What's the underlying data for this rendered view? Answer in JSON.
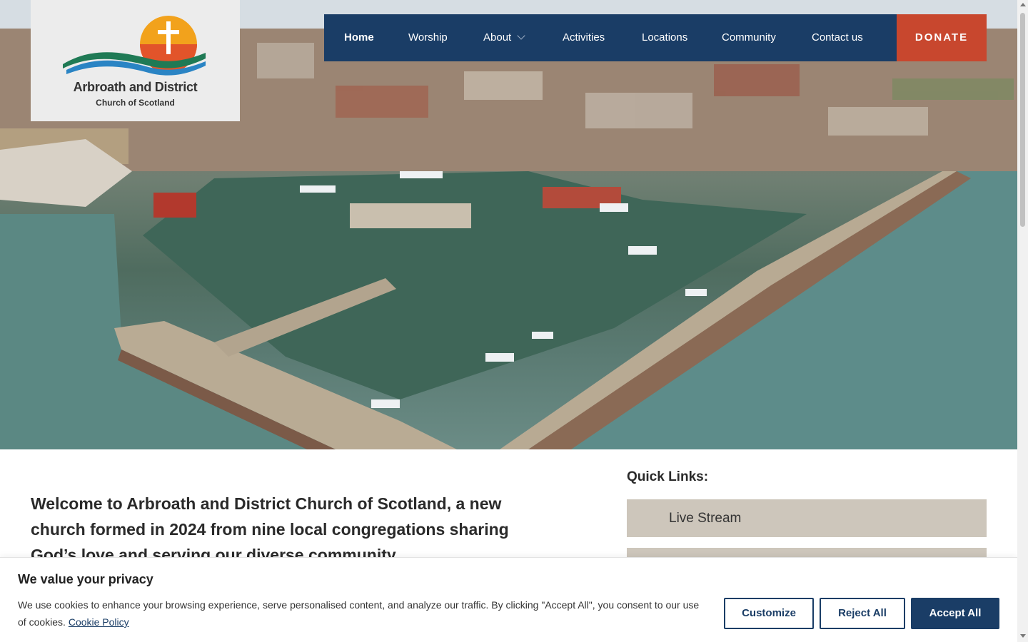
{
  "logo": {
    "title": "Arbroath and District",
    "subtitle": "Church of Scotland"
  },
  "nav": {
    "items": [
      {
        "label": "Home",
        "active": true
      },
      {
        "label": "Worship"
      },
      {
        "label": "About",
        "has_dropdown": true
      },
      {
        "label": "Activities"
      },
      {
        "label": "Locations"
      },
      {
        "label": "Community"
      },
      {
        "label": "Contact us"
      }
    ],
    "donate_label": "DONATE"
  },
  "hero": {
    "alt": "Aerial view of Arbroath harbour"
  },
  "main": {
    "welcome": "Welcome to Arbroath and District Church of Scotland, a new church formed in 2024 from nine local congregations sharing God’s love and serving our diverse community."
  },
  "quick_links": {
    "title": "Quick Links:",
    "items": [
      "Live Stream",
      ""
    ]
  },
  "cookie": {
    "title": "We value your privacy",
    "text": "We use cookies to enhance your browsing experience, serve personalised content, and analyze our traffic. By clicking \"Accept All\", you consent to our use of cookies.",
    "link": "Cookie Policy",
    "customize": "Customize",
    "reject": "Reject All",
    "accept": "Accept All"
  },
  "colors": {
    "nav_bg": "#1a3d66",
    "donate_bg": "#c8472e",
    "quick_link_bg": "#cdc6bb"
  }
}
